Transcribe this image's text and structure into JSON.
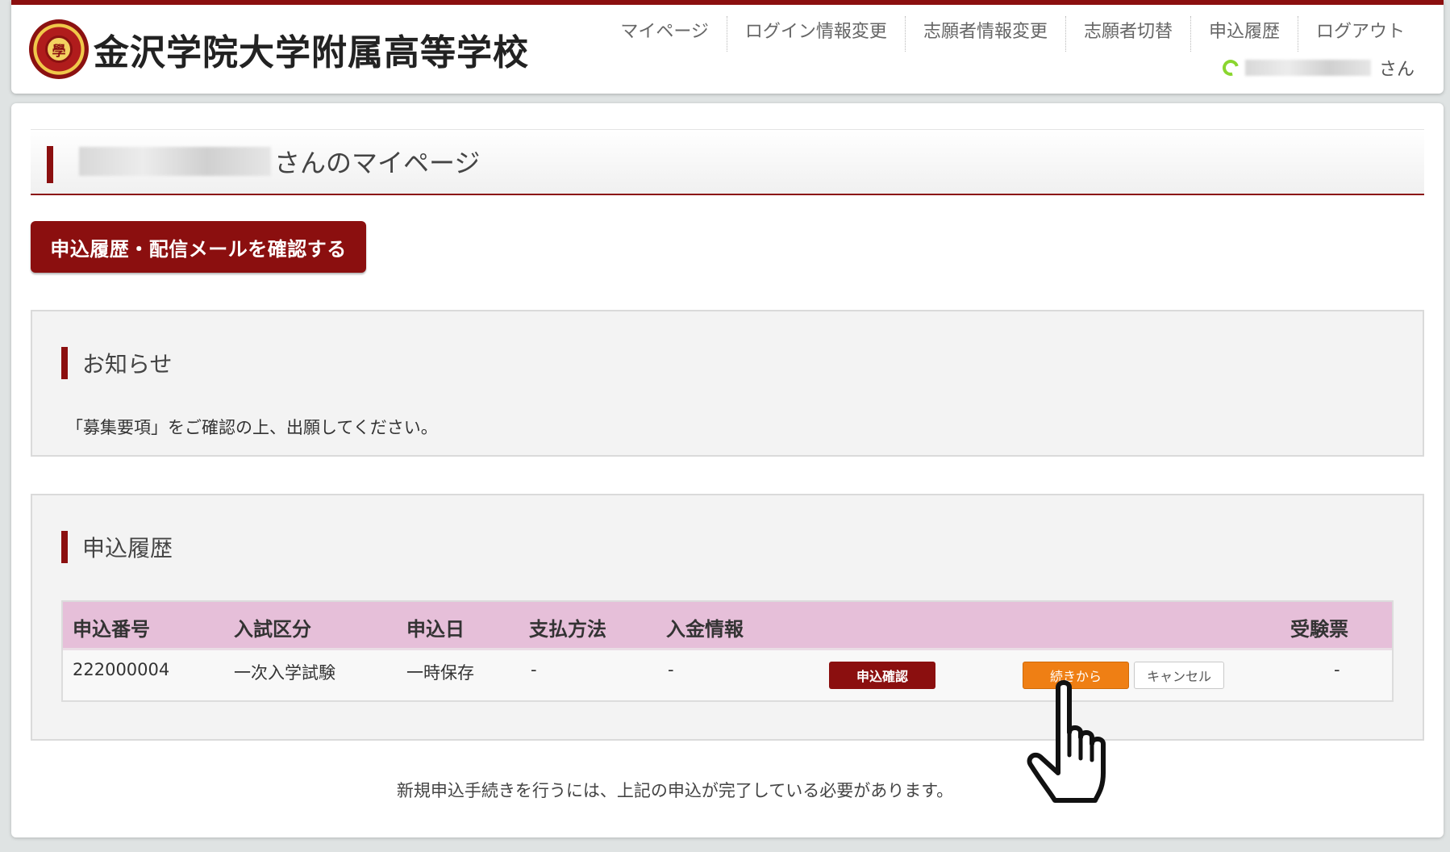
{
  "header": {
    "crest_char": "學",
    "school_name": "金沢学院大学附属高等学校",
    "nav": [
      "マイページ",
      "ログイン情報変更",
      "志願者情報変更",
      "志願者切替",
      "申込履歴",
      "ログアウト"
    ],
    "user_suffix": "さん"
  },
  "page": {
    "title_suffix": "さんのマイページ",
    "history_mail_button": "申込履歴・配信メールを確認する"
  },
  "notice": {
    "heading": "お知らせ",
    "text": "「募集要項」をご確認の上、出願してください。"
  },
  "history": {
    "heading": "申込履歴",
    "columns": [
      "申込番号",
      "入試区分",
      "申込日",
      "支払方法",
      "入金情報",
      "受験票"
    ],
    "rows": [
      {
        "number": "222000004",
        "category": "一次入学試験",
        "date": "一時保存",
        "payment": "-",
        "deposit": "-",
        "confirm_label": "申込確認",
        "continue_label": "続きから",
        "cancel_label": "キャンセル",
        "ticket": "-"
      }
    ]
  },
  "footer": {
    "note": "新規申込手続きを行うには、上記の申込が完了している必要があります。"
  },
  "colors": {
    "brand": "#8b0f0f",
    "table_header": "#e6bfd9",
    "continue_button": "#ef7f14"
  }
}
